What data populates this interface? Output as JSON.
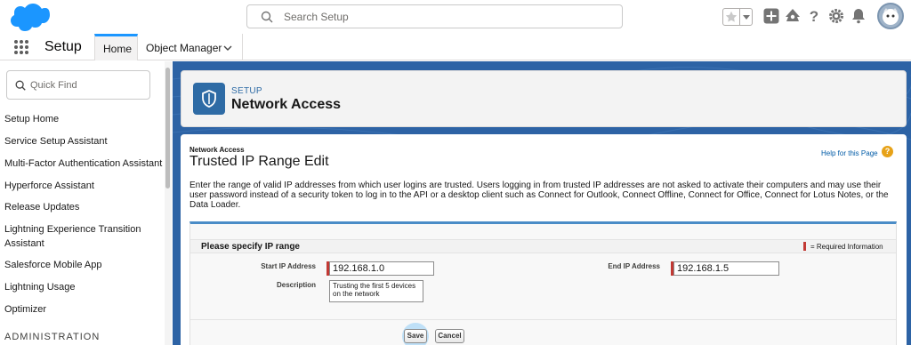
{
  "header": {
    "search_placeholder": "Search Setup",
    "icons": [
      "favorites-star-icon",
      "add-icon",
      "trailhead-icon",
      "help-icon",
      "gear-icon",
      "bell-icon"
    ]
  },
  "nav": {
    "app_name": "Setup",
    "tabs": [
      {
        "label": "Home",
        "active": true
      },
      {
        "label": "Object Manager",
        "active": false
      }
    ]
  },
  "sidebar": {
    "quickfind_placeholder": "Quick Find",
    "items": [
      "Setup Home",
      "Service Setup Assistant",
      "Multi-Factor Authentication Assistant",
      "Hyperforce Assistant",
      "Release Updates",
      "Lightning Experience Transition Assistant",
      "Salesforce Mobile App",
      "Lightning Usage",
      "Optimizer"
    ],
    "section_heading": "ADMINISTRATION"
  },
  "page_header": {
    "subtitle": "SETUP",
    "title": "Network Access"
  },
  "content": {
    "breadcrumb": "Network Access",
    "title": "Trusted IP Range Edit",
    "help_link": "Help for this Page",
    "intro": "Enter the range of valid IP addresses from which user logins are trusted. Users logging in from trusted IP addresses are not asked to activate their computers and may use their user password instead of a security token to log in to the API or a desktop client such as Connect for Outlook, Connect Offline, Connect for Office, Connect for Lotus Notes, or the Data Loader."
  },
  "form": {
    "section_title": "Please specify IP range",
    "required_info": "= Required Information",
    "start_label": "Start IP Address",
    "start_value": "192.168.1.0",
    "end_label": "End IP Address",
    "end_value": "192.168.1.5",
    "description_label": "Description",
    "description_value": "Trusting the first 5 devices on the network",
    "save_label": "Save",
    "cancel_label": "Cancel"
  },
  "colors": {
    "brand_blue": "#2d63a5",
    "tab_accent": "#1b96ff",
    "required_red": "#c23934",
    "help_orange": "#e7a218"
  }
}
